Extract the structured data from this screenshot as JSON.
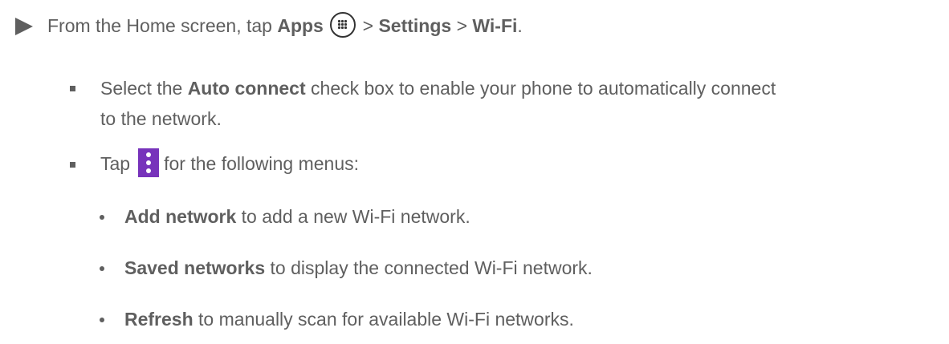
{
  "step": {
    "prefix": "From the Home screen, tap ",
    "apps": "Apps",
    "sep1": " > ",
    "settings": "Settings",
    "sep2": " > ",
    "wifi": "Wi-Fi",
    "end": "."
  },
  "bullet1": {
    "prefix": "Select the ",
    "bold": "Auto connect",
    "suffix": " check box to enable your phone to automatically connect",
    "line2": "to the network."
  },
  "bullet2": {
    "prefix": "Tap",
    "suffix": "for the following menus:"
  },
  "subitems": [
    {
      "bold": "Add network",
      "text": " to add a new Wi-Fi network."
    },
    {
      "bold": "Saved networks",
      "text": " to display the connected Wi-Fi network."
    },
    {
      "bold": "Refresh",
      "text": " to manually scan for available Wi-Fi networks."
    }
  ],
  "icons": {
    "step_marker": "triangle-right-icon",
    "apps": "apps-grid-icon",
    "menu": "more-vert-icon"
  },
  "colors": {
    "text": "#5f5f5f",
    "menu_icon_bg": "#7733bb"
  }
}
